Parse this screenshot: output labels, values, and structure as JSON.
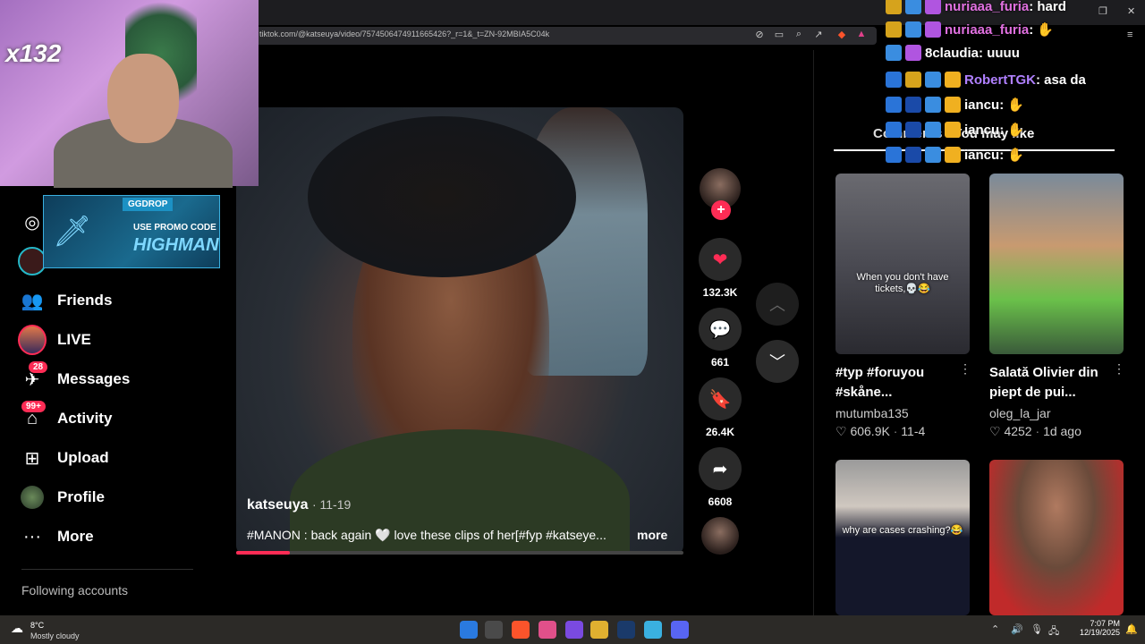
{
  "browser": {
    "url": "tiktok.com/@katseuya/video/7574506474911665426?_r=1&_t=ZN-92MBIA5C04k"
  },
  "overlay": {
    "cam_multiplier": "x132",
    "promo": {
      "brand": "GGDROP",
      "line1": "USE PROMO CODE",
      "line2": "HIGHMAN"
    },
    "chat": [
      {
        "name": "nuriaaa_furia",
        "message": "hard"
      },
      {
        "name": "nuriaaa_furia",
        "message": ""
      },
      {
        "name": "8claudia",
        "message": "uuuu"
      },
      {
        "name": "RobertTGK",
        "message": "asa da"
      },
      {
        "name": "iancu",
        "message": ""
      },
      {
        "name": "iancu",
        "message": ""
      },
      {
        "name": "iancu",
        "message": ""
      }
    ]
  },
  "sidebar": {
    "items": [
      {
        "label": "Friends",
        "icon": "friends-icon"
      },
      {
        "label": "LIVE",
        "icon": "live-icon"
      },
      {
        "label": "Messages",
        "icon": "messages-icon",
        "badge": "28"
      },
      {
        "label": "Activity",
        "icon": "activity-icon",
        "badge": "99+"
      },
      {
        "label": "Upload",
        "icon": "upload-icon"
      },
      {
        "label": "Profile",
        "icon": "profile-icon"
      },
      {
        "label": "More",
        "icon": "more-icon"
      }
    ],
    "following_heading": "Following accounts"
  },
  "video": {
    "author": "katseuya",
    "date": "· 11-19",
    "caption": "#MANON : back again 🤍 love these clips of her[#fyp #katseye...",
    "more_label": "more",
    "progress": 0.12
  },
  "actions": {
    "likes": "132.3K",
    "comments": "661",
    "saves": "26.4K",
    "shares": "6608"
  },
  "right_panel": {
    "tab_label": "Comments",
    "tab_suffix": "You may like",
    "cards": [
      {
        "thumb_text": "When you don't have tickets,💀😂",
        "title": "#typ #foruyou #skåne...",
        "author": "mutumba135",
        "likes": "606.9K",
        "date": "11-4"
      },
      {
        "thumb_text": "",
        "title": "Salată Olivier din piept de pui...",
        "author": "oleg_la_jar",
        "likes": "4252",
        "date": "1d ago"
      },
      {
        "thumb_text": "why are cases crashing?😂",
        "title": "",
        "author": "",
        "likes": "",
        "date": ""
      },
      {
        "thumb_text": "",
        "title": "",
        "author": "",
        "likes": "",
        "date": ""
      }
    ]
  },
  "taskbar": {
    "temperature": "8°C",
    "weather": "Mostly cloudy",
    "time": "7:07 PM",
    "date": "12/19/2025"
  }
}
